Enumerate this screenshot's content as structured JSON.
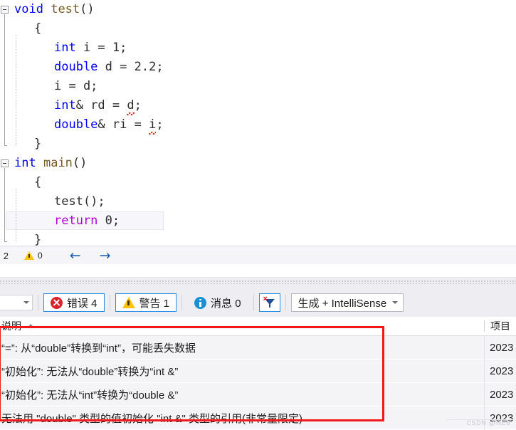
{
  "editor": {
    "lines": [
      {
        "indent": 0,
        "fold": true,
        "tokens": [
          {
            "t": "void",
            "c": "kw"
          },
          {
            "t": " ",
            "c": "plain"
          },
          {
            "t": "test",
            "c": "fn"
          },
          {
            "t": "()",
            "c": "plain"
          }
        ]
      },
      {
        "indent": 1,
        "fold": false,
        "tokens": [
          {
            "t": "{",
            "c": "brace"
          }
        ]
      },
      {
        "indent": 2,
        "fold": false,
        "tokens": [
          {
            "t": "int",
            "c": "kw"
          },
          {
            "t": " i = ",
            "c": "plain"
          },
          {
            "t": "1",
            "c": "num"
          },
          {
            "t": ";",
            "c": "plain"
          }
        ]
      },
      {
        "indent": 2,
        "fold": false,
        "tokens": [
          {
            "t": "double",
            "c": "kw"
          },
          {
            "t": " d = ",
            "c": "plain"
          },
          {
            "t": "2.2",
            "c": "num"
          },
          {
            "t": ";",
            "c": "plain"
          }
        ]
      },
      {
        "indent": 2,
        "fold": false,
        "tokens": [
          {
            "t": "i = d;",
            "c": "plain"
          }
        ]
      },
      {
        "indent": 2,
        "fold": false,
        "tokens": [
          {
            "t": "int",
            "c": "kw"
          },
          {
            "t": "& rd = ",
            "c": "plain"
          },
          {
            "t": "d",
            "c": "plain",
            "squiggle": true
          },
          {
            "t": ";",
            "c": "plain"
          }
        ]
      },
      {
        "indent": 2,
        "fold": false,
        "tokens": [
          {
            "t": "double",
            "c": "kw"
          },
          {
            "t": "& ri = ",
            "c": "plain"
          },
          {
            "t": "i",
            "c": "plain",
            "squiggle": true
          },
          {
            "t": ";",
            "c": "plain"
          }
        ]
      },
      {
        "indent": 1,
        "fold": false,
        "tokens": [
          {
            "t": "}",
            "c": "brace"
          }
        ]
      },
      {
        "indent": 0,
        "fold": true,
        "tokens": [
          {
            "t": "int",
            "c": "kw"
          },
          {
            "t": " ",
            "c": "plain"
          },
          {
            "t": "main",
            "c": "fn"
          },
          {
            "t": "()",
            "c": "plain"
          }
        ]
      },
      {
        "indent": 1,
        "fold": false,
        "tokens": [
          {
            "t": "{",
            "c": "brace"
          }
        ]
      },
      {
        "indent": 2,
        "fold": false,
        "tokens": [
          {
            "t": "test();",
            "c": "plain"
          }
        ]
      },
      {
        "indent": 2,
        "fold": false,
        "current": true,
        "tokens": [
          {
            "t": "return",
            "c": "ret"
          },
          {
            "t": " ",
            "c": "plain"
          },
          {
            "t": "0",
            "c": "num"
          },
          {
            "t": ";",
            "c": "plain"
          }
        ]
      },
      {
        "indent": 1,
        "fold": false,
        "tokens": [
          {
            "t": "}",
            "c": "brace"
          }
        ]
      }
    ]
  },
  "statusbar": {
    "left_count": "2",
    "warning_count": "0",
    "back_arrow": "←",
    "forward_arrow": "→"
  },
  "toolbar": {
    "scope_combo_value": "",
    "errors_label": "错误 4",
    "warnings_label": "警告 1",
    "messages_label": "消息 0",
    "clear_filter_tooltip": "清除筛选器",
    "source_combo_label": "生成 + IntelliSense",
    "accent_blue": "#2d8ce0",
    "error_red": "#d8232a",
    "warning_yellow": "#ffc20e",
    "info_blue": "#1a8fd4"
  },
  "grid": {
    "columns": [
      "说明",
      "项目"
    ],
    "rows": [
      {
        "description": "“=”: 从“double”转换到“int”，可能丢失数据",
        "project": "2023"
      },
      {
        "description": "“初始化”: 无法从“double”转换为“int &”",
        "project": "2023"
      },
      {
        "description": "“初始化”: 无法从“int”转换为“double &”",
        "project": "2023"
      },
      {
        "description": "无法用 \"double\" 类型的值初始化 \"int &\" 类型的引用(非常量限定)",
        "project": "2023"
      }
    ],
    "highlight_color": "#f01818"
  },
  "watermark": {
    "text": "CSDN @%E6"
  }
}
